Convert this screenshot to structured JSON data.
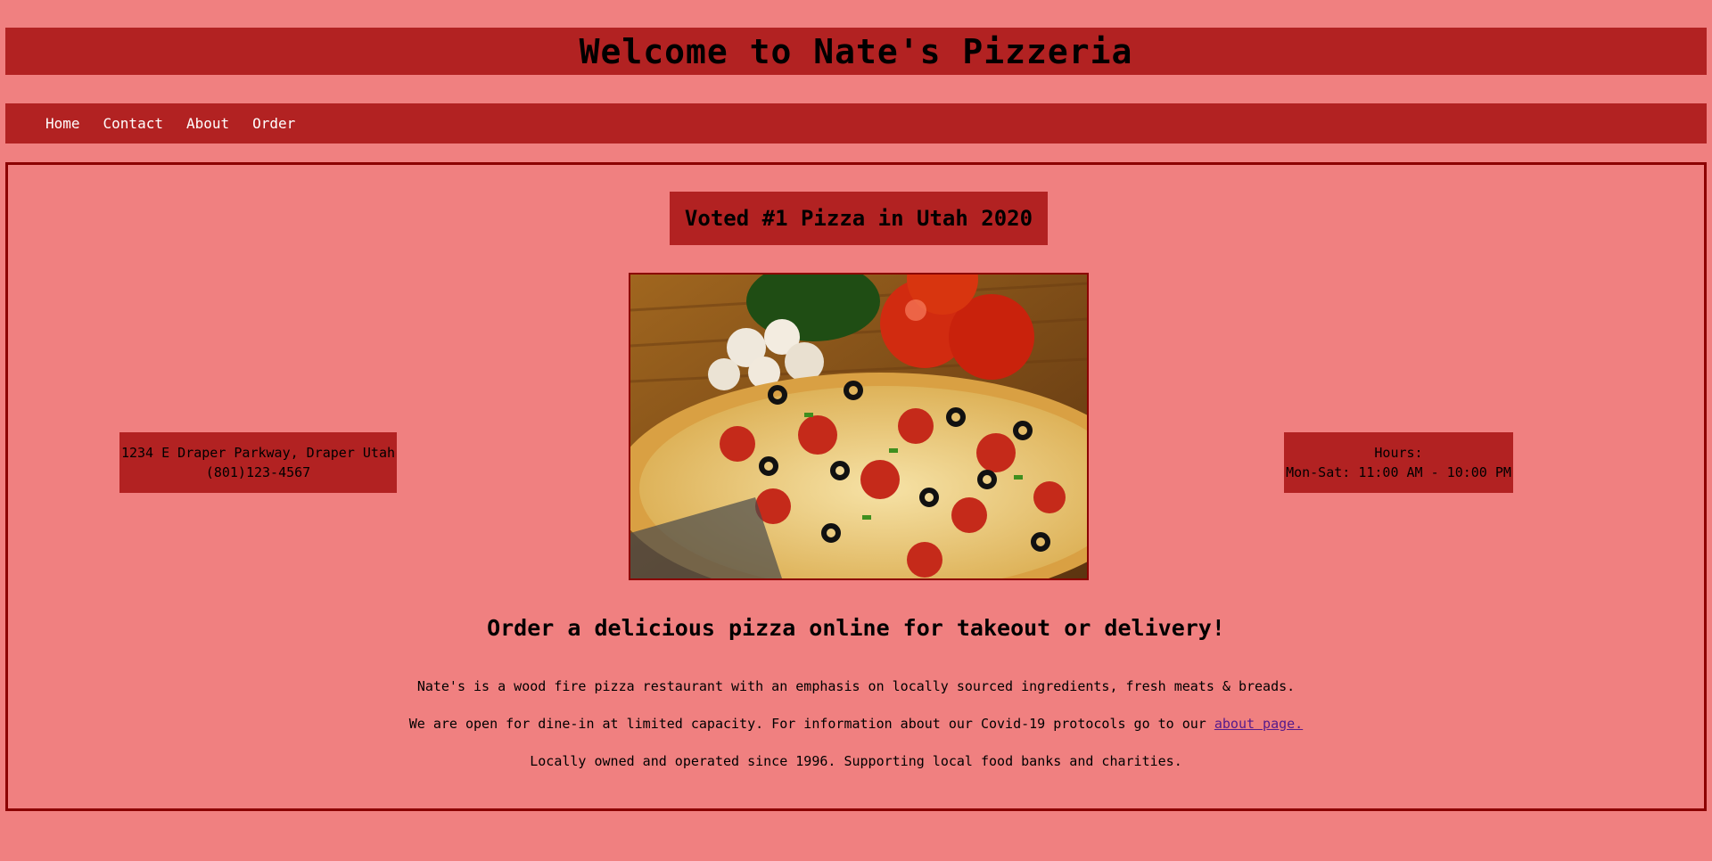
{
  "header": {
    "title": "Welcome to Nate's Pizzeria"
  },
  "nav": {
    "items": [
      {
        "label": "Home"
      },
      {
        "label": "Contact"
      },
      {
        "label": "About"
      },
      {
        "label": "Order"
      }
    ]
  },
  "main": {
    "badge": "Voted #1 Pizza in Utah 2020",
    "address": {
      "line1": "1234 E Draper Parkway, Draper Utah",
      "phone": "(801)123-4567"
    },
    "hours": {
      "label": "Hours:",
      "value": "Mon-Sat: 11:00 AM - 10:00 PM"
    },
    "cta": "Order a delicious pizza online for takeout or delivery!",
    "paragraph1": "Nate's is a wood fire pizza restaurant with an emphasis on locally sourced ingredients, fresh meats & breads.",
    "paragraph2_text": "We are open for dine-in at limited capacity. For information about our Covid-19 protocols go to our ",
    "paragraph2_link": "about page.",
    "paragraph3": "Locally owned and operated since 1996. Supporting local food banks and charities."
  },
  "colors": {
    "background": "#f08080",
    "accent": "#b22222",
    "border": "#8b0000",
    "nav_text": "#ffffff",
    "link": "#551a8b"
  }
}
